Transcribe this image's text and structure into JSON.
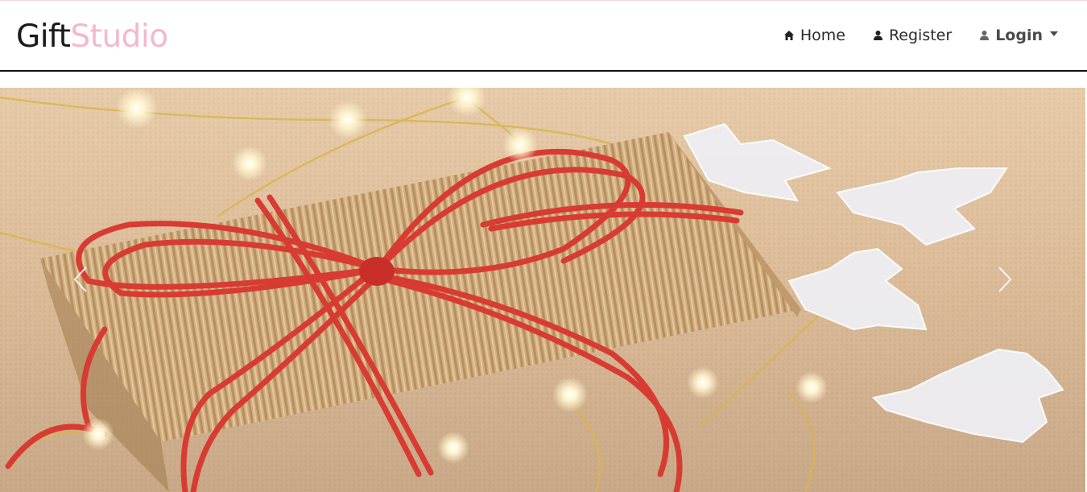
{
  "brand": {
    "part1": "Gift",
    "part2": "Studio",
    "accent_color": "#f3b8cf"
  },
  "nav": {
    "home_label": "Home",
    "home_icon": "house-icon",
    "register_label": "Register",
    "register_icon": "person-icon",
    "login_label": "Login",
    "login_icon": "person-icon"
  },
  "carousel": {
    "slide_image": "gift-box-with-red-twine-bow",
    "prev_icon": "chevron-left-icon",
    "next_icon": "chevron-right-icon"
  }
}
